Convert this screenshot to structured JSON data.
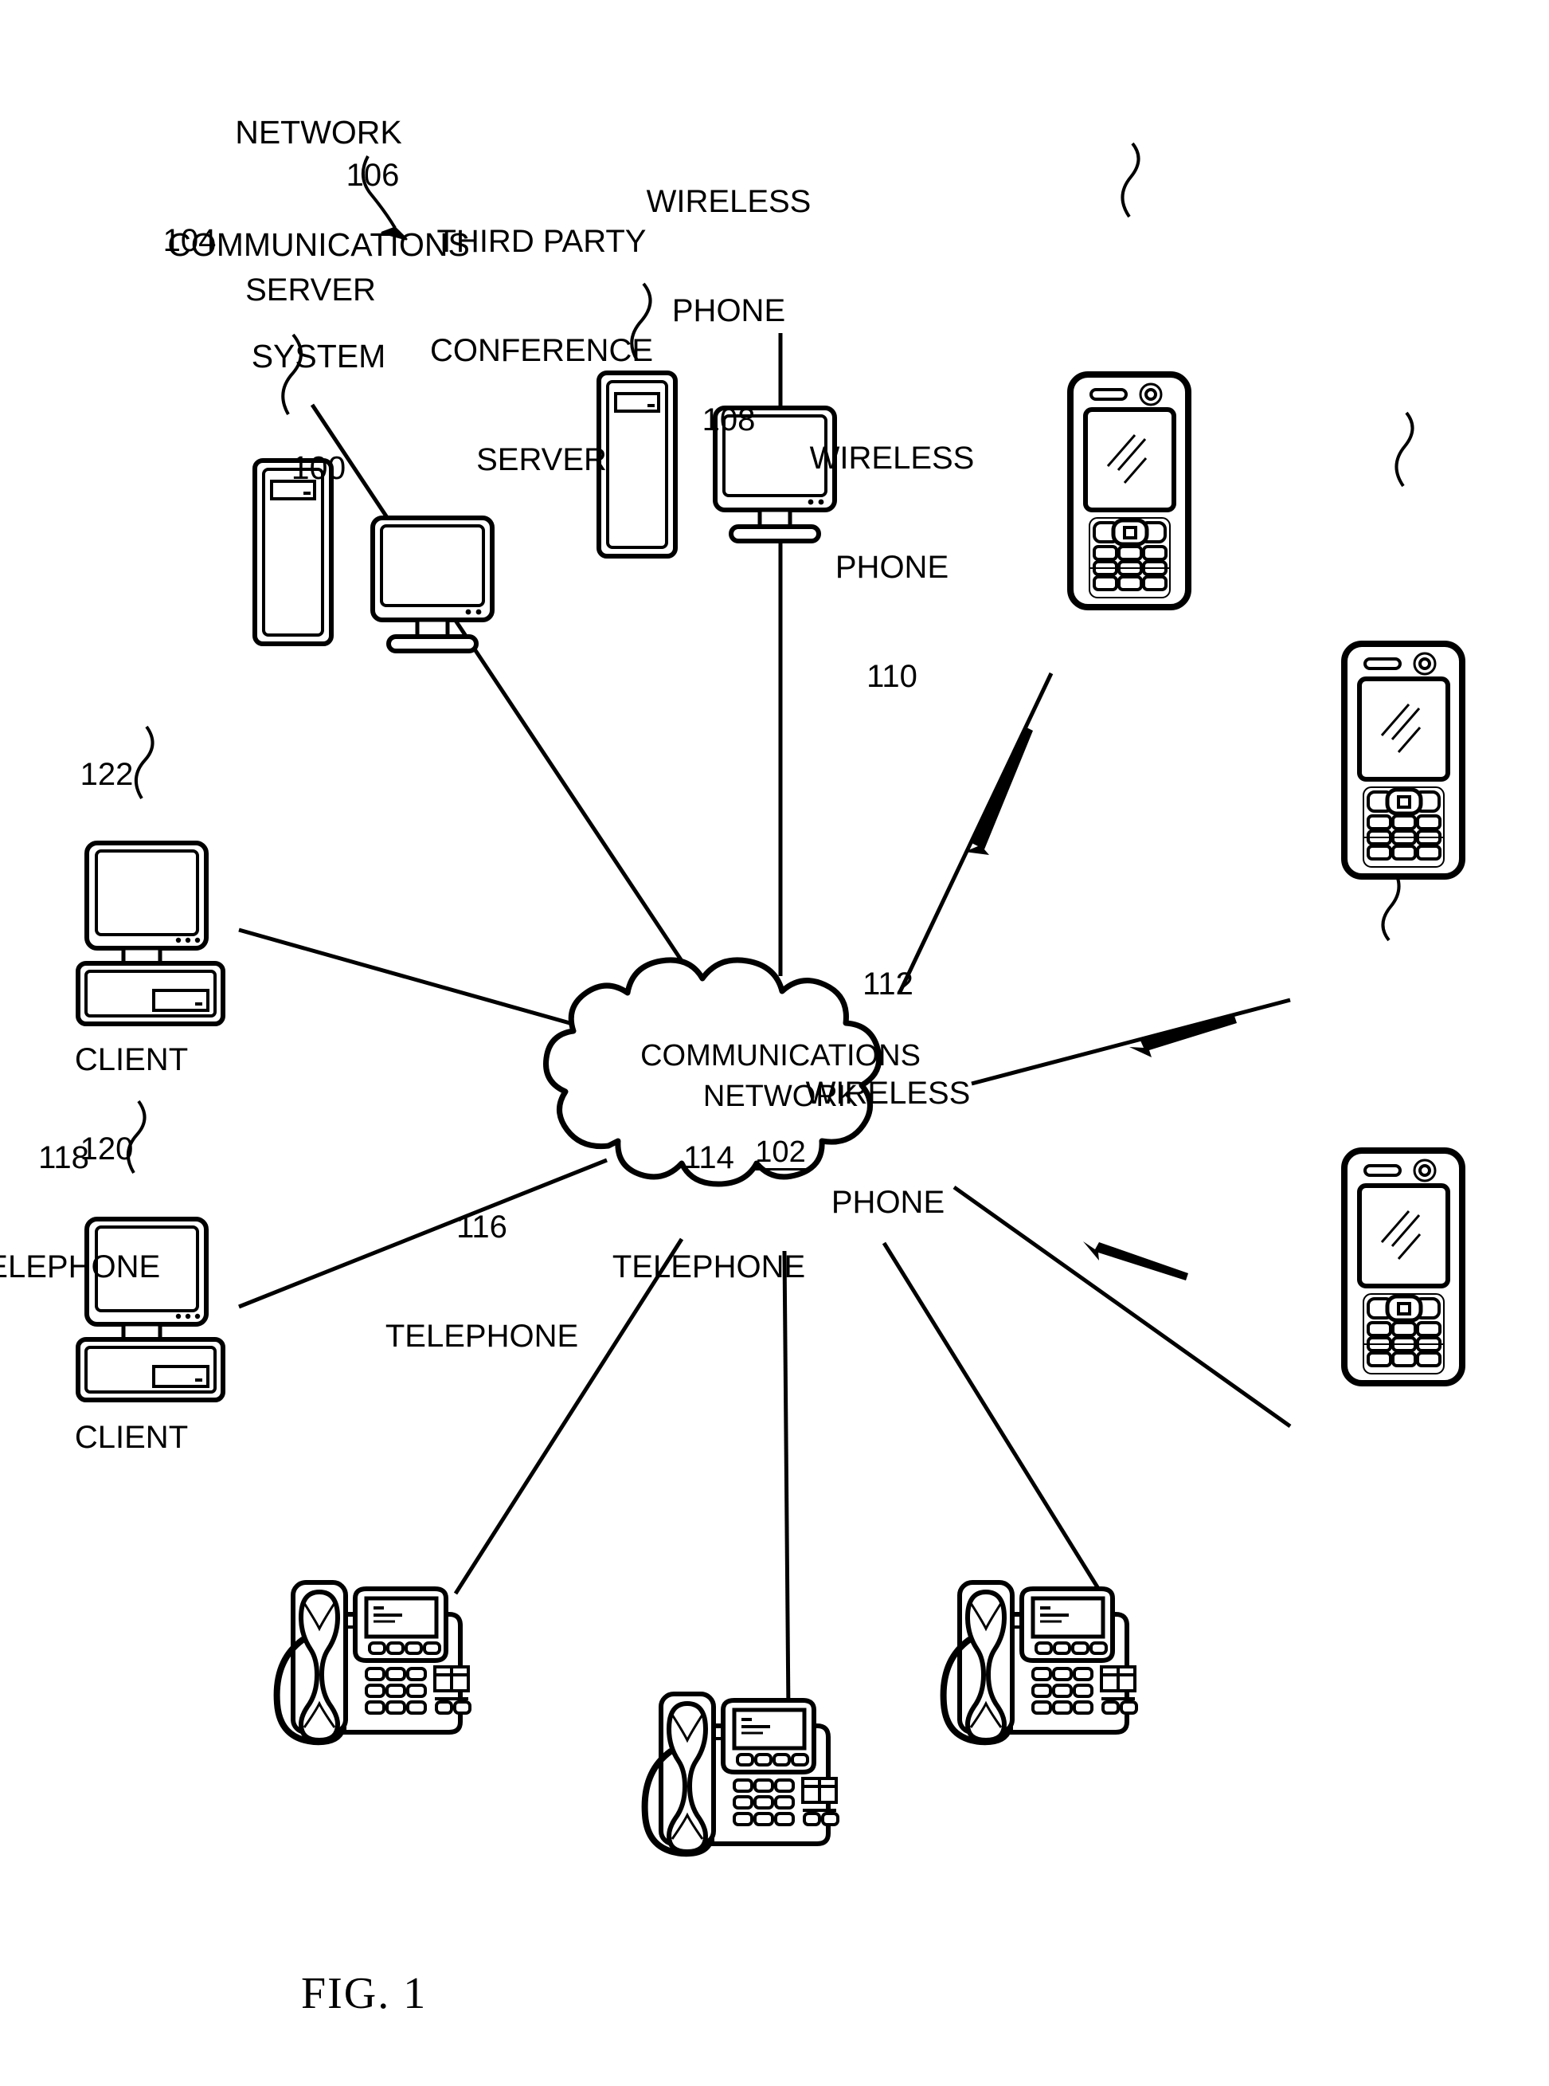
{
  "figure": {
    "caption": "FIG. 1",
    "title_lines": [
      "NETWORK",
      "COMMUNICATIONS",
      "SYSTEM"
    ],
    "title_ref": "100"
  },
  "network": {
    "name_line1": "COMMUNICATIONS",
    "name_line2": "NETWORK",
    "ref": "102"
  },
  "nodes": {
    "server_104": {
      "ref": "104",
      "label": "SERVER"
    },
    "conference_server_106": {
      "ref": "106",
      "label_line1": "THIRD PARTY",
      "label_line2": "CONFERENCE",
      "label_line3": "SERVER"
    },
    "wireless_phone_108": {
      "label_line1": "WIRELESS",
      "label_line2": "PHONE",
      "ref": "108"
    },
    "wireless_phone_110": {
      "label_line1": "WIRELESS",
      "label_line2": "PHONE",
      "ref": "110"
    },
    "wireless_phone_112": {
      "ref": "112",
      "label_line1": "WIRELESS",
      "label_line2": "PHONE"
    },
    "telephone_114": {
      "ref": "114",
      "label": "TELEPHONE"
    },
    "telephone_116": {
      "ref": "116",
      "label": "TELEPHONE"
    },
    "telephone_118": {
      "ref": "118",
      "label": "TELEPHONE"
    },
    "client_120": {
      "ref": "120",
      "label": "CLIENT"
    },
    "client_122": {
      "ref": "122",
      "label": "CLIENT"
    }
  },
  "colors": {
    "ink": "#000000",
    "paper": "#ffffff"
  }
}
